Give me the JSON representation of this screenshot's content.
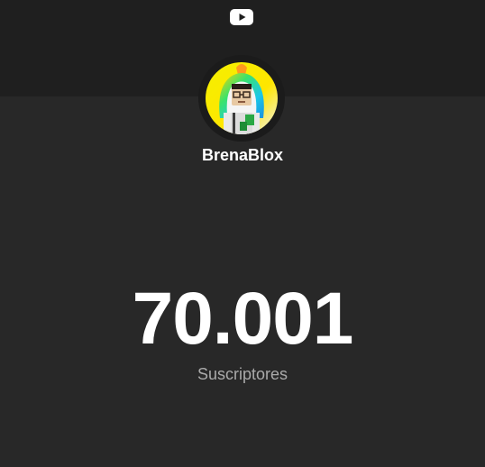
{
  "channel": {
    "name": "BrenaBlox"
  },
  "counter": {
    "value": "70.001",
    "label": "Suscriptores"
  },
  "icons": {
    "logo": "youtube-play-icon"
  },
  "colors": {
    "background": "#282828",
    "header_band": "#1f1f1f",
    "text_primary": "#ffffff",
    "text_secondary": "#aaaaaa",
    "logo": "#ffffff"
  }
}
